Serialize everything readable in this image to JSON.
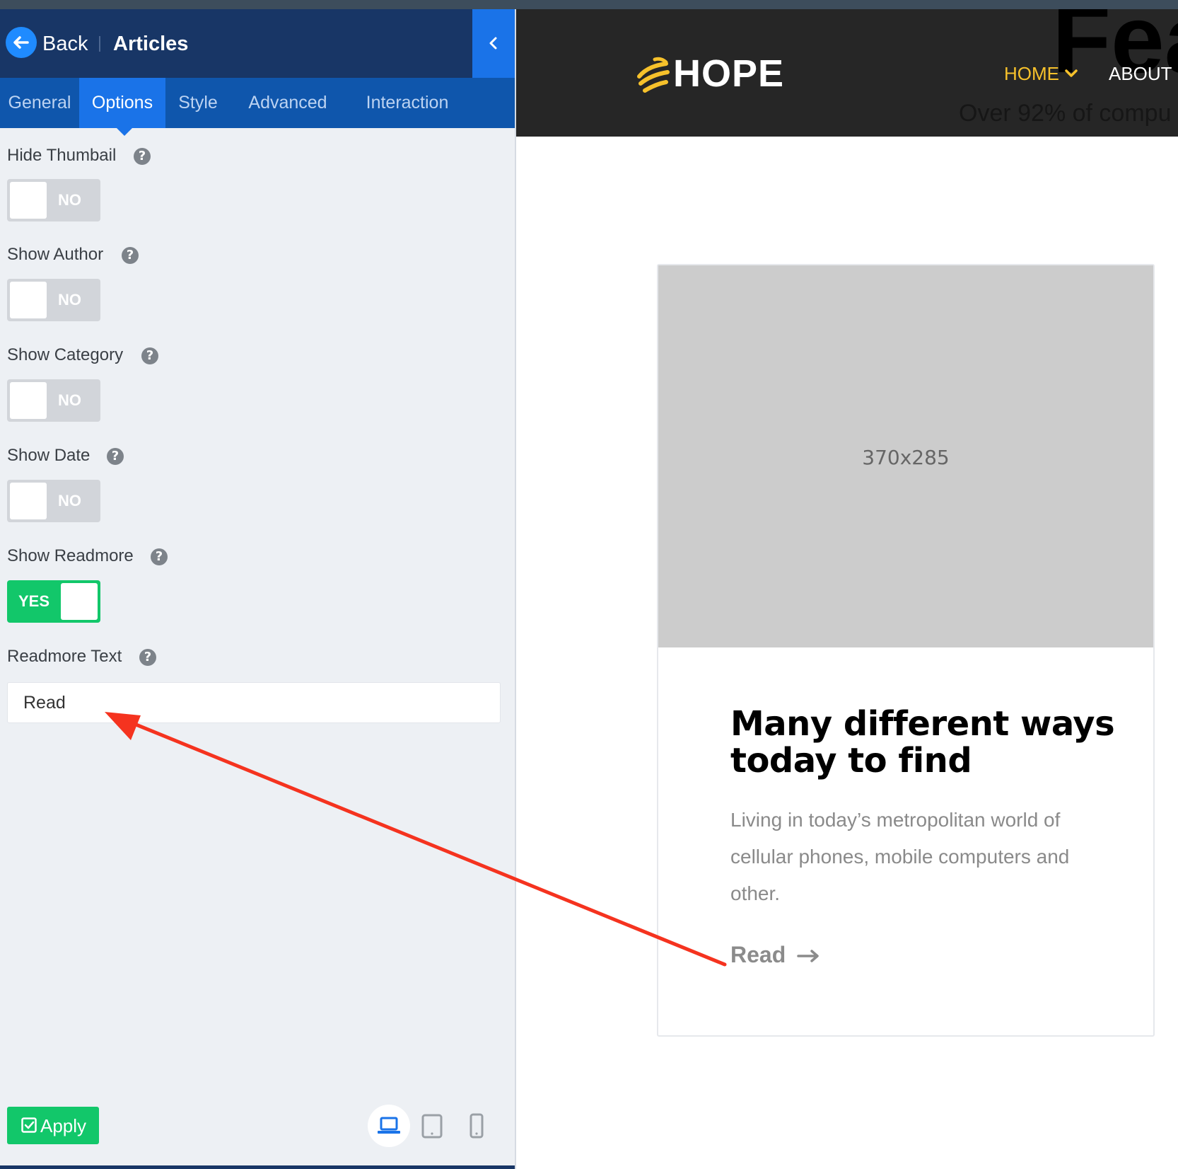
{
  "editor": {
    "header": {
      "back_label": "Back",
      "title": "Articles"
    },
    "tabs": [
      "General",
      "Options",
      "Style",
      "Advanced",
      "Interaction"
    ],
    "active_tab": "Options",
    "fields": [
      {
        "label": "Hide Thumbail",
        "type": "toggle",
        "value": "NO"
      },
      {
        "label": "Show Author",
        "type": "toggle",
        "value": "NO"
      },
      {
        "label": "Show Category",
        "type": "toggle",
        "value": "NO"
      },
      {
        "label": "Show Date",
        "type": "toggle",
        "value": "NO"
      },
      {
        "label": "Show Readmore",
        "type": "toggle",
        "value": "YES"
      },
      {
        "label": "Readmore Text",
        "type": "text",
        "value": "Read"
      }
    ],
    "help_glyph": "?",
    "apply_label": "Apply",
    "devices": [
      "laptop-icon",
      "tablet-icon",
      "mobile-icon"
    ],
    "active_device": "laptop-icon"
  },
  "site": {
    "logo_text": "HOPE",
    "nav": {
      "home": "HOME",
      "about": "ABOUT"
    },
    "ghost_heading": "Fea",
    "ghost_subtitle": "Over 92% of compu",
    "colors": {
      "accent": "#f6c12b",
      "header_bg": "#262626"
    }
  },
  "card": {
    "thumb_placeholder": "370x285",
    "title": "Many different ways today to find",
    "text": "Living in today’s metropolitan world of cellular phones, mobile computers and other.",
    "readmore": "Read"
  },
  "annotation": {
    "color": "#f5331f"
  }
}
